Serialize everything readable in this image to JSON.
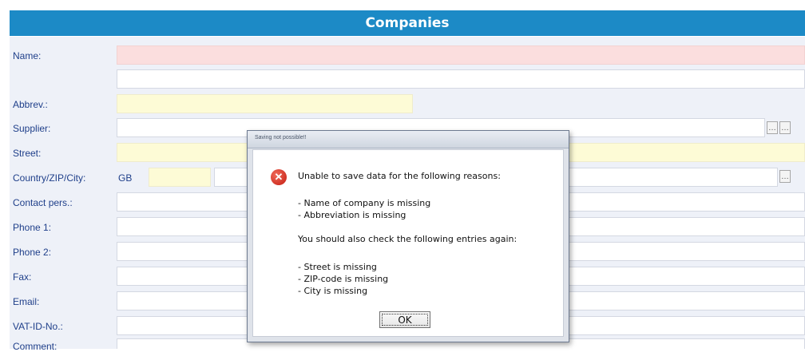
{
  "header": {
    "title": "Companies"
  },
  "form": {
    "labels": {
      "name": "Name:",
      "abbrev": "Abbrev.:",
      "supplier": "Supplier:",
      "street": "Street:",
      "country_zip_city": "Country/ZIP/City:",
      "contact": "Contact pers.:",
      "phone1": "Phone 1:",
      "phone2": "Phone 2:",
      "fax": "Fax:",
      "email": "Email:",
      "vat": "VAT-ID-No.:",
      "comment": "Comment:"
    },
    "values": {
      "country": "GB"
    },
    "supplier_button_label": "…",
    "country_button_label": "…"
  },
  "dialog": {
    "title": "Saving not possible!!",
    "intro": "Unable to save data for the following reasons:",
    "errors": [
      "- Name of company is missing",
      "- Abbreviation is missing"
    ],
    "check_intro": "You should also check the following entries again:",
    "warnings": [
      "- Street is missing",
      "- ZIP-code is missing",
      "- City is missing"
    ],
    "ok_label": "OK"
  },
  "colors": {
    "header_bg": "#1c8ac6",
    "required_empty": "#fbdede",
    "required_hint": "#fdfbd6",
    "label_text": "#1f3f8a",
    "form_bg": "#eef1f8"
  },
  "icons": {
    "dialog_icon": "error-icon"
  }
}
